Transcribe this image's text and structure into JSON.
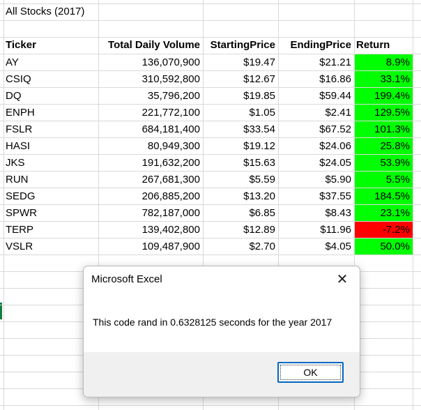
{
  "sheet": {
    "title": "All Stocks (2017)",
    "headers": [
      "Ticker",
      "Total Daily Volume",
      "StartingPrice",
      "EndingPrice",
      "Return"
    ],
    "rows": [
      {
        "ticker": "AY",
        "volume": "136,070,900",
        "start": "$19.47",
        "end": "$21.21",
        "ret": "8.9%",
        "status": "positive"
      },
      {
        "ticker": "CSIQ",
        "volume": "310,592,800",
        "start": "$12.67",
        "end": "$16.86",
        "ret": "33.1%",
        "status": "positive"
      },
      {
        "ticker": "DQ",
        "volume": "35,796,200",
        "start": "$19.85",
        "end": "$59.44",
        "ret": "199.4%",
        "status": "positive"
      },
      {
        "ticker": "ENPH",
        "volume": "221,772,100",
        "start": "$1.05",
        "end": "$2.41",
        "ret": "129.5%",
        "status": "positive"
      },
      {
        "ticker": "FSLR",
        "volume": "684,181,400",
        "start": "$33.54",
        "end": "$67.52",
        "ret": "101.3%",
        "status": "positive"
      },
      {
        "ticker": "HASI",
        "volume": "80,949,300",
        "start": "$19.12",
        "end": "$24.06",
        "ret": "25.8%",
        "status": "positive"
      },
      {
        "ticker": "JKS",
        "volume": "191,632,200",
        "start": "$15.63",
        "end": "$24.05",
        "ret": "53.9%",
        "status": "positive"
      },
      {
        "ticker": "RUN",
        "volume": "267,681,300",
        "start": "$5.59",
        "end": "$5.90",
        "ret": "5.5%",
        "status": "positive"
      },
      {
        "ticker": "SEDG",
        "volume": "206,885,200",
        "start": "$13.20",
        "end": "$37.55",
        "ret": "184.5%",
        "status": "positive"
      },
      {
        "ticker": "SPWR",
        "volume": "782,187,000",
        "start": "$6.85",
        "end": "$8.43",
        "ret": "23.1%",
        "status": "positive"
      },
      {
        "ticker": "TERP",
        "volume": "139,402,800",
        "start": "$12.89",
        "end": "$11.96",
        "ret": "-7.2%",
        "status": "negative"
      },
      {
        "ticker": "VSLR",
        "volume": "109,487,900",
        "start": "$2.70",
        "end": "$4.05",
        "ret": "50.0%",
        "status": "positive"
      }
    ]
  },
  "dialog": {
    "title": "Microsoft Excel",
    "message": "This code rand in 0.6328125 seconds for the year 2017",
    "ok_label": "OK",
    "close_glyph": "✕"
  },
  "colors": {
    "positive": "#00ff00",
    "negative": "#ff0000",
    "gridline": "#d9d9d9",
    "accent": "#0067c0"
  }
}
